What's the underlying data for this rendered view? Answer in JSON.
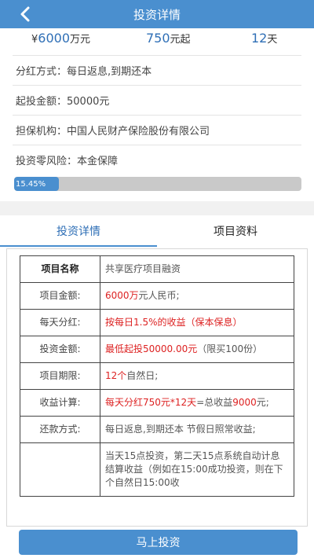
{
  "header": {
    "title": "投资详情"
  },
  "stats": {
    "amount_prefix": "¥",
    "amount_value": "6000",
    "amount_unit": "万元",
    "min_value": "750",
    "min_unit": "元起",
    "term_value": "12",
    "term_unit": "天"
  },
  "info_rows": [
    "分红方式：每日返息,到期还本",
    "起投金额：50000元",
    "担保机构：中国人民财产保险股份有限公司",
    "投资零风险：本金保障"
  ],
  "progress": {
    "label": "15.45%",
    "value_percent": 15.45
  },
  "tabs": [
    {
      "label": "投资详情",
      "active": true
    },
    {
      "label": "项目资料",
      "active": false
    }
  ],
  "detail_table": {
    "rows": [
      {
        "label": "项目名称",
        "value": "共享医疗项目融资"
      },
      {
        "label": "项目金额:",
        "red": "6000万",
        "rest": "元人民币;"
      },
      {
        "label": "每天分红:",
        "red": "按每日1.5%的收益（保本保息）",
        "rest": ""
      },
      {
        "label": "投资金额:",
        "red": "最低起投50000.00元",
        "rest": "（限买100份）"
      },
      {
        "label": "项目期限:",
        "red": "12个",
        "rest": "自然日;"
      },
      {
        "label": "收益计算:",
        "red": "每天分红750元*12天",
        "rest": "=总收益",
        "red2": "9000",
        "rest2": "元;"
      },
      {
        "label": "还款方式:",
        "value": "每日返息,到期还本 节假日照常收益;"
      },
      {
        "label": "",
        "value": "当天15点投资，第二天15点系统自动计息结算收益（例如在15:00成功投资，则在下个自然日15:00收"
      }
    ]
  },
  "cta": {
    "label": "马上投资"
  },
  "colors": {
    "primary": "#4a8fcf",
    "accent_red": "#d22222"
  }
}
